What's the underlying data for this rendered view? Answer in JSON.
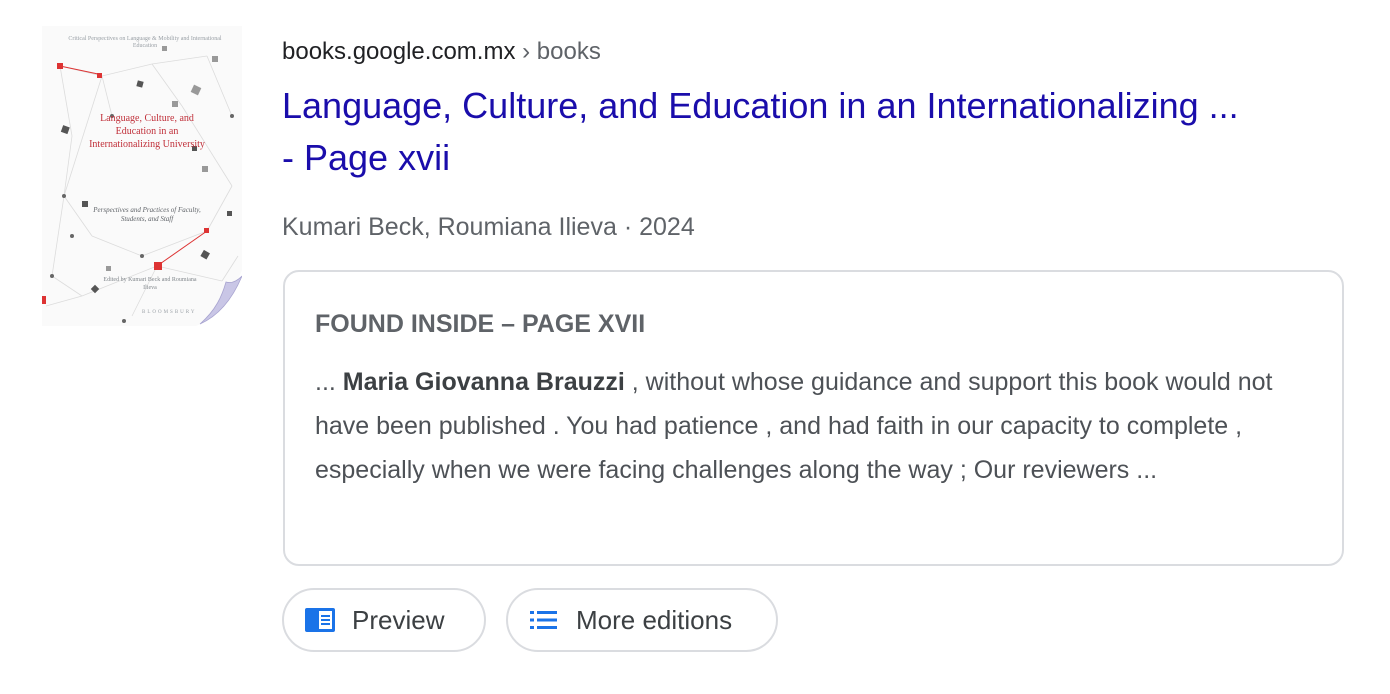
{
  "cover": {
    "header_text": "Critical Perspectives on Language & Mobility and International Education",
    "title_text": "Language, Culture, and Education in an Internationalizing University",
    "subtitle_text": "Perspectives and Practices of Faculty, Students, and Staff",
    "editors_text": "Edited by Kumari Beck and Roumiana Ilieva",
    "publisher_text": "BLOOMSBURY",
    "accent_color": "#c0303a"
  },
  "breadcrumb": {
    "domain": "books.google.com.mx",
    "separator": "›",
    "path": "books"
  },
  "title": {
    "line1": "Language, Culture, and Education in an Internationalizing ...",
    "line2": "- Page xvii"
  },
  "meta": {
    "authors": "Kumari Beck, Roumiana Ilieva",
    "separator": "·",
    "year": "2024"
  },
  "snippet": {
    "heading": "FOUND INSIDE – PAGE XVII",
    "prefix": "...",
    "bold_name": "Maria Giovanna Brauzzi",
    "text": ", without whose guidance and support this book would not have been published . You had patience , and had faith in our capacity to complete , especially when we were facing challenges along the way ; Our reviewers ..."
  },
  "chips": {
    "preview": {
      "label": "Preview",
      "icon": "book-preview-icon"
    },
    "more_editions": {
      "label": "More editions",
      "icon": "list-icon"
    }
  },
  "colors": {
    "link": "#1a0dab",
    "text": "#202124",
    "secondary": "#5f6368",
    "border": "#dadce0",
    "icon_blue": "#1a73e8"
  }
}
